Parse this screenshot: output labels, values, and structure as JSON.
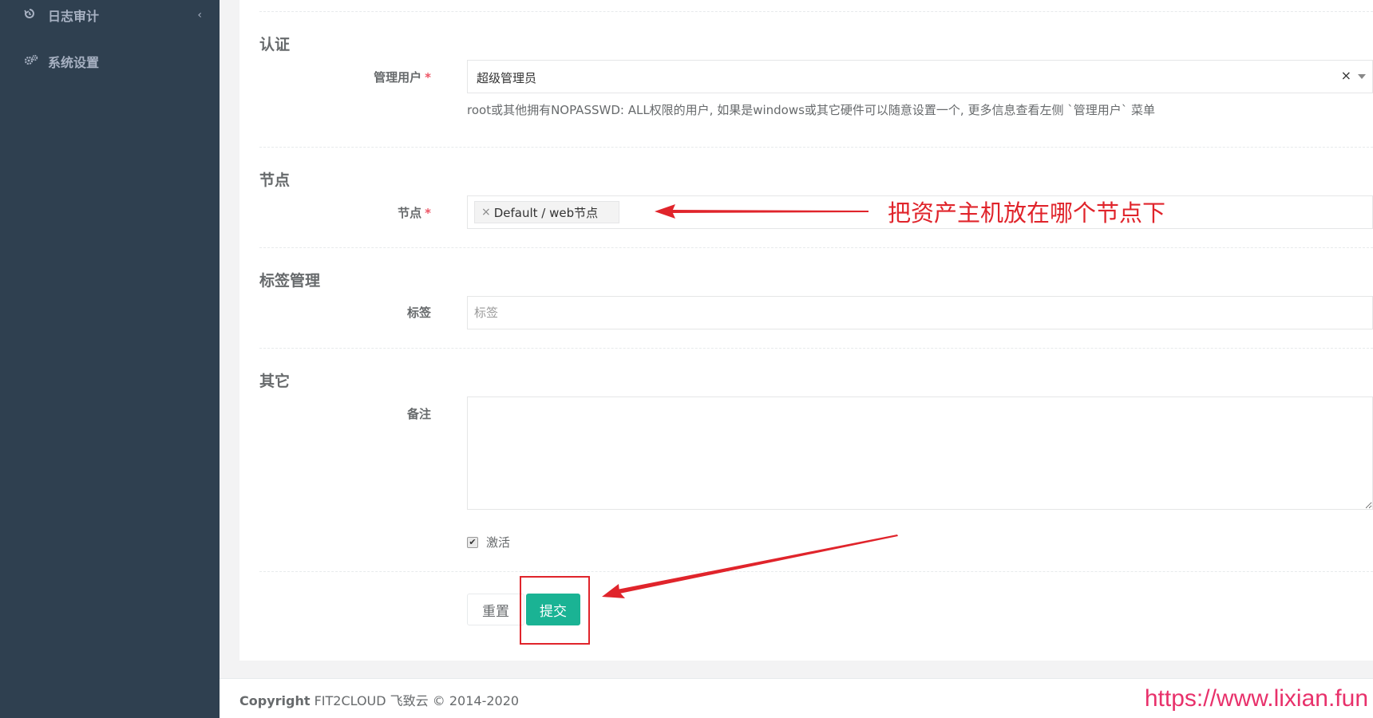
{
  "sidebar": {
    "items": [
      {
        "label": "日志审计",
        "icon": "history-icon"
      },
      {
        "label": "系统设置",
        "icon": "gears-icon"
      }
    ]
  },
  "sections": {
    "auth": {
      "title": "认证",
      "admin_label": "管理用户",
      "admin_value": "超级管理员",
      "clear_glyph": "×",
      "admin_help": "root或其他拥有NOPASSWD: ALL权限的用户, 如果是windows或其它硬件可以随意设置一个, 更多信息查看左侧 `管理用户` 菜单"
    },
    "nodes": {
      "title": "节点",
      "node_label": "节点",
      "chip_remove": "×",
      "chip_value": "Default / web节点"
    },
    "labels": {
      "title": "标签管理",
      "label_field": "标签",
      "label_placeholder": "标签"
    },
    "other": {
      "title": "其它",
      "comment_label": "备注",
      "active_label": "激活",
      "active_checked": true
    }
  },
  "required_mark": "*",
  "checkbox_glyph": "✔",
  "buttons": {
    "reset": "重置",
    "submit": "提交"
  },
  "annotation": {
    "node_hint": "把资产主机放在哪个节点下"
  },
  "footer": {
    "brand": "Copyright",
    "text": " FIT2CLOUD 飞致云 © 2014-2020",
    "watermark": "https://www.lixian.fun"
  },
  "colors": {
    "sidebar": "#2f4050",
    "primary": "#1ab394",
    "annotation": "#e0242b",
    "watermark": "#e8316b",
    "required": "#ed5565"
  }
}
